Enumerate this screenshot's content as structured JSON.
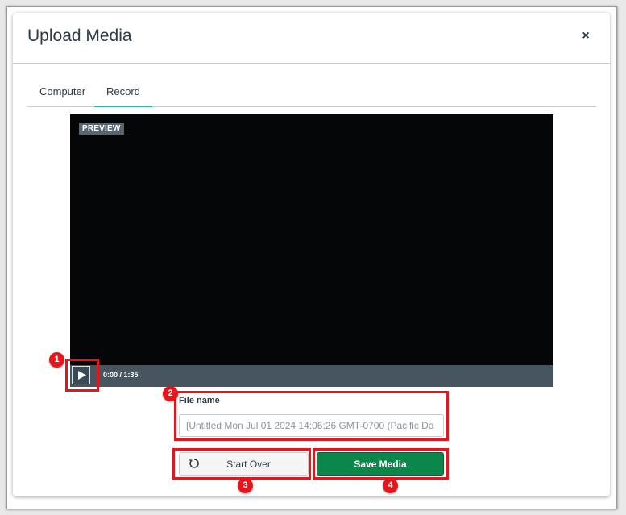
{
  "modal": {
    "title": "Upload Media",
    "close_label": "×"
  },
  "tabs": [
    {
      "label": "Computer",
      "active": false
    },
    {
      "label": "Record",
      "active": true
    }
  ],
  "video": {
    "preview_label": "PREVIEW",
    "time": "0:00 / 1:35",
    "play_icon": "play-icon"
  },
  "file_name": {
    "label": "File name",
    "value": "[Untitled Mon Jul 01 2024 14:06:26 GMT-0700 (Pacific Da"
  },
  "buttons": {
    "start_over": "Start Over",
    "start_over_icon": "refresh-icon",
    "save_media": "Save Media"
  },
  "annotations": {
    "badges": [
      "1",
      "2",
      "3",
      "4"
    ],
    "color": "#e8141b"
  },
  "colors": {
    "accent_tab": "#2bb5b0",
    "save_button": "#0b874b"
  }
}
